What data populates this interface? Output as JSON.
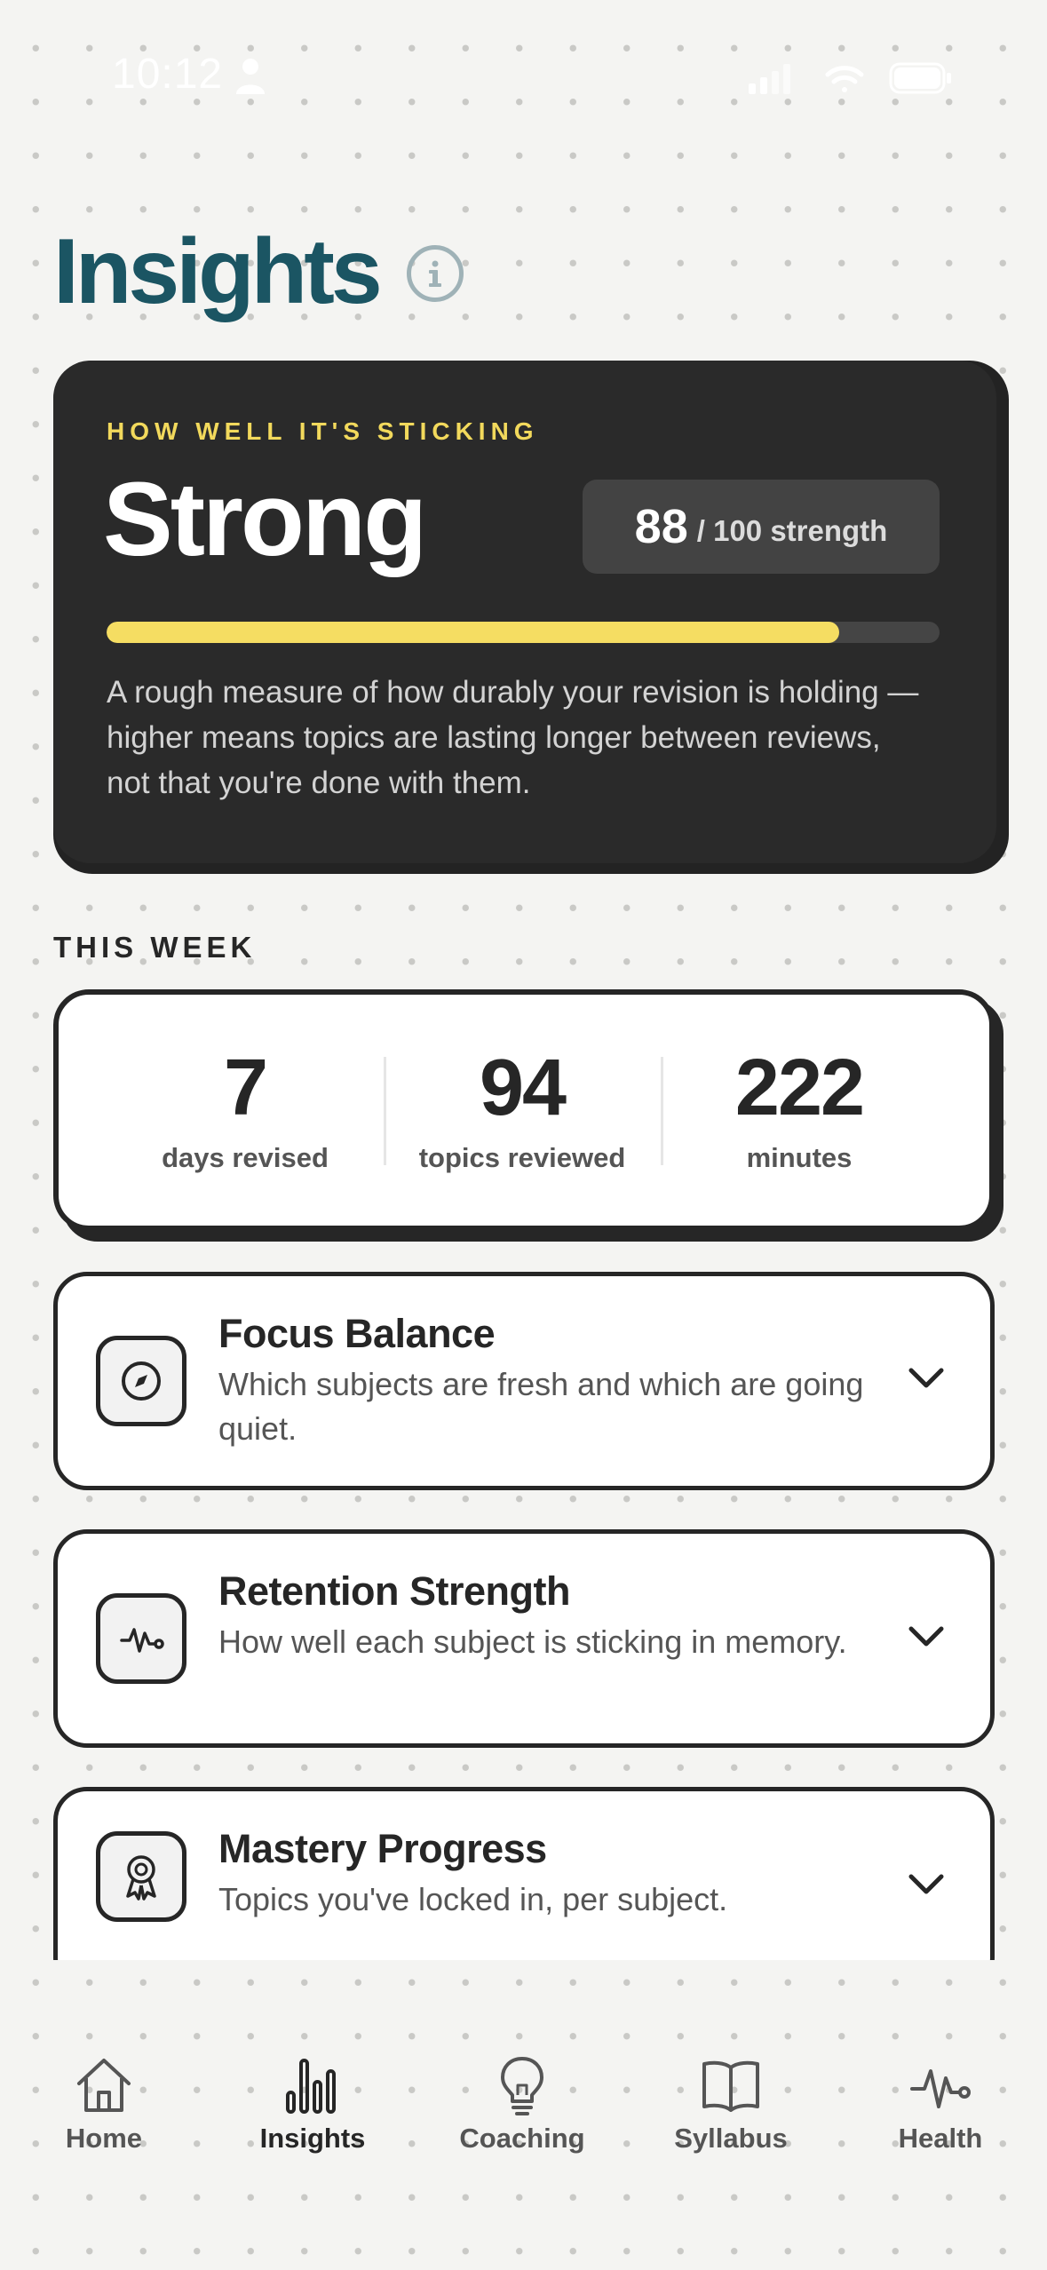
{
  "status_bar": {
    "time": "10:12"
  },
  "header": {
    "title": "Insights"
  },
  "strength": {
    "eyebrow": "HOW WELL IT'S STICKING",
    "level": "Strong",
    "score": "88",
    "score_suffix": "/ 100 strength",
    "progress": 0.88,
    "description": "A rough measure of how durably your revision is holding — higher means topics are lasting longer between reviews, not that you're done with them."
  },
  "this_week": {
    "label": "THIS WEEK",
    "stats": [
      {
        "value": "7",
        "label": "days revised"
      },
      {
        "value": "94",
        "label": "topics reviewed"
      },
      {
        "value": "222",
        "label": "minutes"
      }
    ]
  },
  "insights": [
    {
      "title": "Focus Balance",
      "description": "Which subjects are fresh and which are going quiet.",
      "icon": "compass-icon"
    },
    {
      "title": "Retention Strength",
      "description": "How well each subject is sticking in memory.",
      "icon": "pulse-icon"
    },
    {
      "title": "Mastery Progress",
      "description": "Topics you've locked in, per subject.",
      "icon": "award-icon"
    }
  ],
  "tabs": [
    {
      "label": "Home",
      "icon": "home-icon",
      "active": false
    },
    {
      "label": "Insights",
      "icon": "bar-chart-icon",
      "active": true
    },
    {
      "label": "Coaching",
      "icon": "lightbulb-icon",
      "active": false
    },
    {
      "label": "Syllabus",
      "icon": "book-icon",
      "active": false
    },
    {
      "label": "Health",
      "icon": "pulse-icon",
      "active": false
    }
  ],
  "colors": {
    "title": "#1b5563",
    "accent_yellow": "#f5dd62",
    "card_dark": "#2a2a2a",
    "ink": "#262626"
  }
}
